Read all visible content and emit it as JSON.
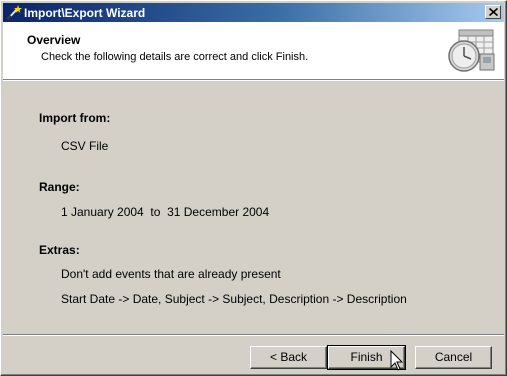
{
  "window": {
    "title": "Import\\Export Wizard",
    "icons": {
      "app": "wand-icon",
      "close": "close-icon",
      "header": "calendar-clock-icon"
    }
  },
  "header": {
    "title": "Overview",
    "subtitle": "Check the following details are correct and click Finish."
  },
  "summary": {
    "import_from_label": "Import from:",
    "import_from_value": "CSV File",
    "range_label": "Range:",
    "range_value": "1 January 2004  to  31 December 2004",
    "extras_label": "Extras:",
    "extras": [
      "Don't add events that are already present",
      "Start Date -> Date, Subject -> Subject, Description -> Description"
    ]
  },
  "buttons": {
    "back": "< Back",
    "finish": "Finish",
    "cancel": "Cancel"
  }
}
